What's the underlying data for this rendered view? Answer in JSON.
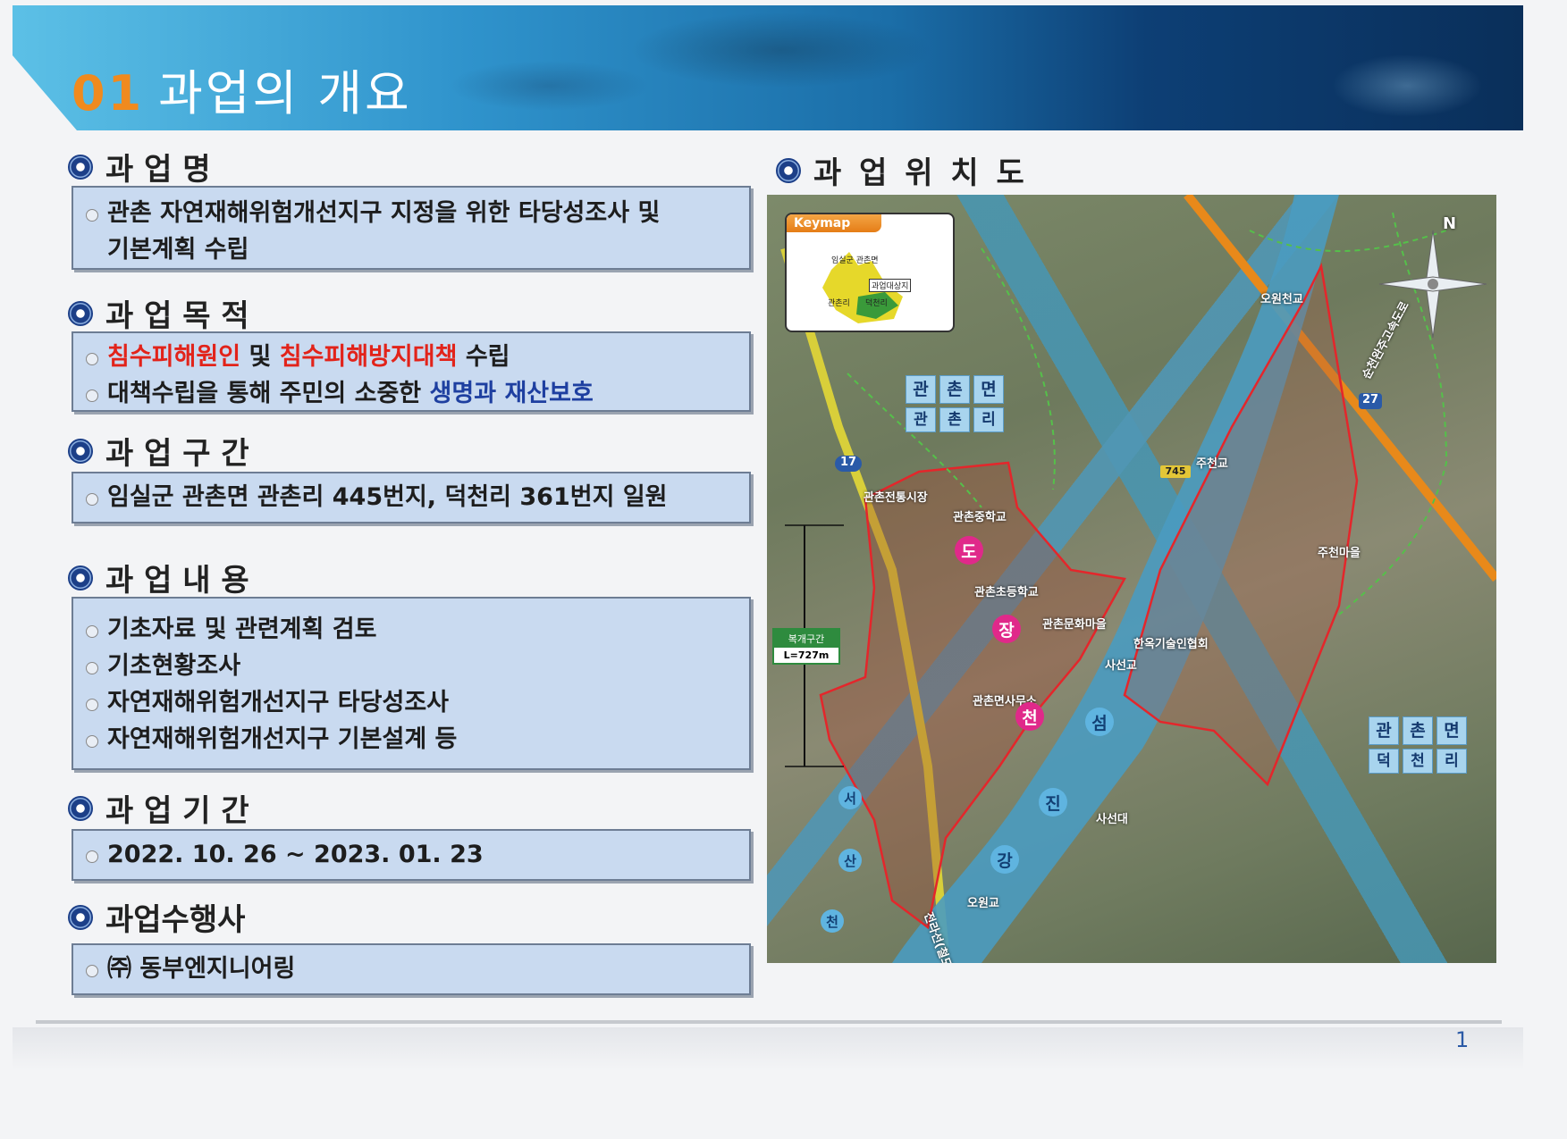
{
  "header": {
    "number": "01",
    "title": "과업의 개요"
  },
  "sections": {
    "name": {
      "heading": "과 업 명",
      "items": [
        "관촌 자연재해위험개선지구 지정을 위한 타당성조사 및",
        "기본계획 수립"
      ]
    },
    "purpose": {
      "heading": "과 업 목 적",
      "line1": {
        "red1": "침수피해원인",
        "mid": " 및 ",
        "red2": "침수피해방지대책",
        "end": " 수립"
      },
      "line2": {
        "start": "대책수립을 통해 주민의 소중한 ",
        "blue": "생명과 재산보호"
      }
    },
    "section": {
      "heading": "과 업 구 간",
      "items": [
        "임실군 관촌면 관촌리 445번지, 덕천리 361번지 일원"
      ]
    },
    "content": {
      "heading": "과 업 내 용",
      "items": [
        "기초자료 및 관련계획 검토",
        "기초현황조사",
        "자연재해위험개선지구 타당성조사",
        "자연재해위험개선지구 기본설계 등"
      ]
    },
    "period": {
      "heading": "과 업 기 간",
      "items": [
        "2022. 10. 26 ~ 2023. 01. 23"
      ]
    },
    "contractor": {
      "heading": "과업수행사",
      "items": [
        "㈜ 동부엔지니어링"
      ]
    }
  },
  "location": {
    "heading": "과 업 위 치 도",
    "keymap": {
      "title": "Keymap",
      "labels": [
        "임실군 관촌면",
        "과업대상지",
        "관촌리",
        "덕천리"
      ]
    },
    "north": "N",
    "region_left": {
      "top": [
        "관",
        "촌",
        "면"
      ],
      "bottom": [
        "관",
        "촌",
        "리"
      ]
    },
    "region_right": {
      "top": [
        "관",
        "촌",
        "면"
      ],
      "bottom": [
        "덕",
        "천",
        "리"
      ]
    },
    "places": {
      "bridge_owon_top": "오원천교",
      "bridge_jucheon": "주천교",
      "bridge_sasun": "사선교",
      "bridge_owon_bottom": "오원교",
      "market": "관촌전통시장",
      "middle_school": "관촌중학교",
      "elementary": "관촌초등학교",
      "culture_village": "관촌문화마을",
      "hanok": "한옥기술인협회",
      "office": "관촌면사무소",
      "jucheon_village": "주천마을",
      "sasundae": "사선대",
      "railway": "전라선(철도)",
      "highway": "순천완주고속도로"
    },
    "roads": {
      "route17": "17",
      "route745": "745",
      "route27": "27"
    },
    "town_stream": [
      "도",
      "장",
      "천"
    ],
    "river": [
      "섬",
      "진",
      "강"
    ],
    "seosan_stream": [
      "서",
      "산",
      "천"
    ],
    "length_box": {
      "title": "복개구간",
      "value": "L=727m"
    }
  },
  "page_number": "1"
}
